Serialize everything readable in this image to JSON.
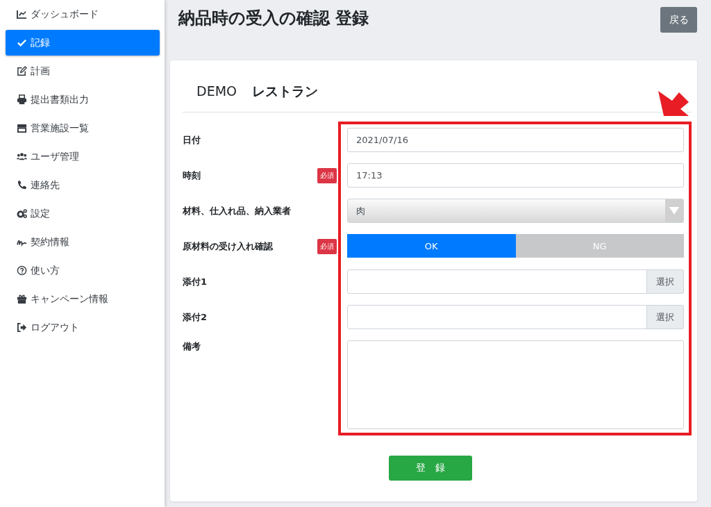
{
  "sidebar": {
    "items": [
      {
        "label": "ダッシュボード",
        "selected": false
      },
      {
        "label": "記録",
        "selected": true
      },
      {
        "label": "計画",
        "selected": false
      },
      {
        "label": "提出書類出力",
        "selected": false
      },
      {
        "label": "営業施設一覧",
        "selected": false
      },
      {
        "label": "ユーザ管理",
        "selected": false
      },
      {
        "label": "連絡先",
        "selected": false
      },
      {
        "label": "設定",
        "selected": false
      },
      {
        "label": "契約情報",
        "selected": false
      },
      {
        "label": "使い方",
        "selected": false
      },
      {
        "label": "キャンペーン情報",
        "selected": false
      },
      {
        "label": "ログアウト",
        "selected": false
      }
    ]
  },
  "page": {
    "title": "納品時の受入の確認 登録",
    "back_button": "戻る"
  },
  "card": {
    "company": "DEMO",
    "store": "レストラン"
  },
  "fields": [
    {
      "kind": "text",
      "label": "日付",
      "value": "2021/07/16"
    },
    {
      "kind": "text",
      "label": "時刻",
      "badge": "必須",
      "value": "17:13"
    },
    {
      "kind": "select",
      "label": "材料、仕入れ品、納入業者",
      "value": "肉"
    },
    {
      "kind": "toggle",
      "label": "原材料の受け入れ確認",
      "badge": "必須",
      "options": [
        {
          "label": "OK",
          "selected": true
        },
        {
          "label": "NG",
          "selected": false
        }
      ]
    },
    {
      "kind": "file",
      "label": "添付1",
      "button": "選択"
    },
    {
      "kind": "file",
      "label": "添付2",
      "button": "選択"
    },
    {
      "kind": "textarea",
      "label": "備考"
    }
  ],
  "submit_button": "登　録"
}
